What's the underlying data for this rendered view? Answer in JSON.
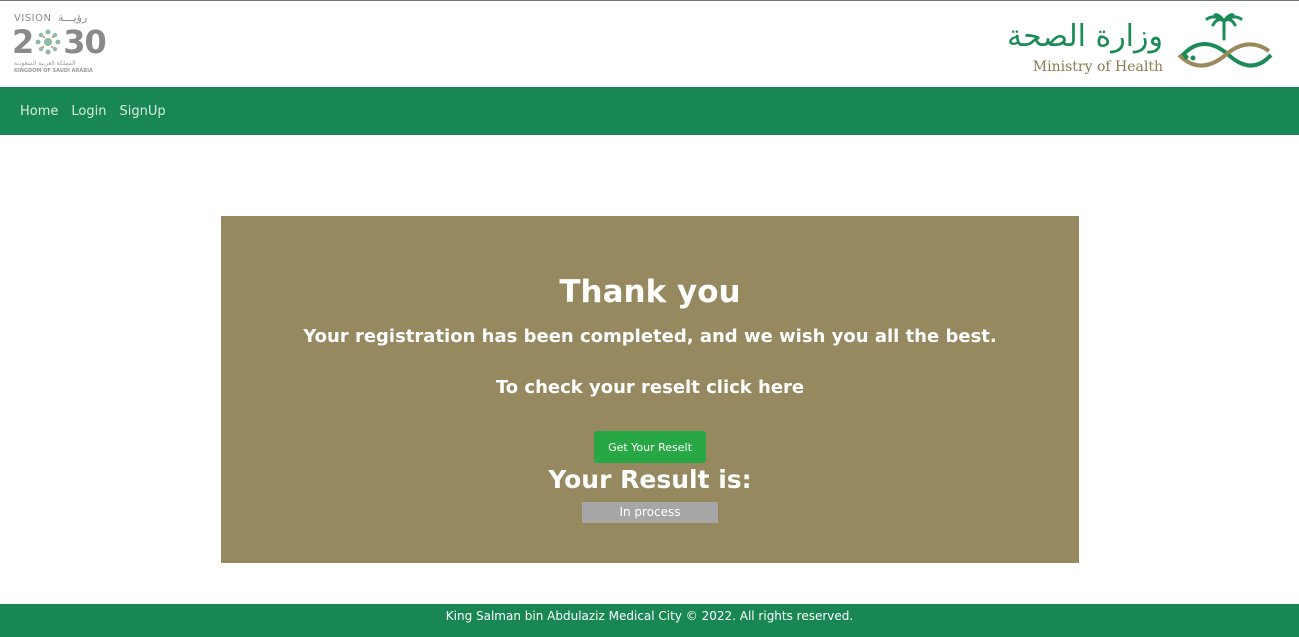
{
  "header": {
    "vision_logo": {
      "top_text": "VISION",
      "arabic_text": "رؤيـــة",
      "year_left": "2",
      "year_right": "30",
      "sub_arabic": "المملكة العربية السعودية",
      "sub_english": "KINGDOM OF SAUDI ARABIA"
    },
    "moh_logo": {
      "arabic": "وزارة الصحة",
      "english": "Ministry of Health"
    }
  },
  "nav": {
    "items": [
      {
        "label": "Home"
      },
      {
        "label": "Login"
      },
      {
        "label": "SignUp"
      }
    ]
  },
  "card": {
    "title": "Thank you",
    "message": "Your registration has been completed, and we wish you all the best.",
    "check_prompt": "To check your reselt click here",
    "button_label": "Get Your Reselt",
    "result_heading": "Your Result is:",
    "result_status": "In process"
  },
  "footer": {
    "text": "King Salman bin Abdulaziz Medical City © 2022. All rights reserved."
  },
  "colors": {
    "nav_green": "#198754",
    "card_bg": "#96885f",
    "button_green": "#28a745",
    "status_gray": "#a6a6a6",
    "moh_green": "#1a8a56",
    "moh_gold": "#8a7c50"
  }
}
